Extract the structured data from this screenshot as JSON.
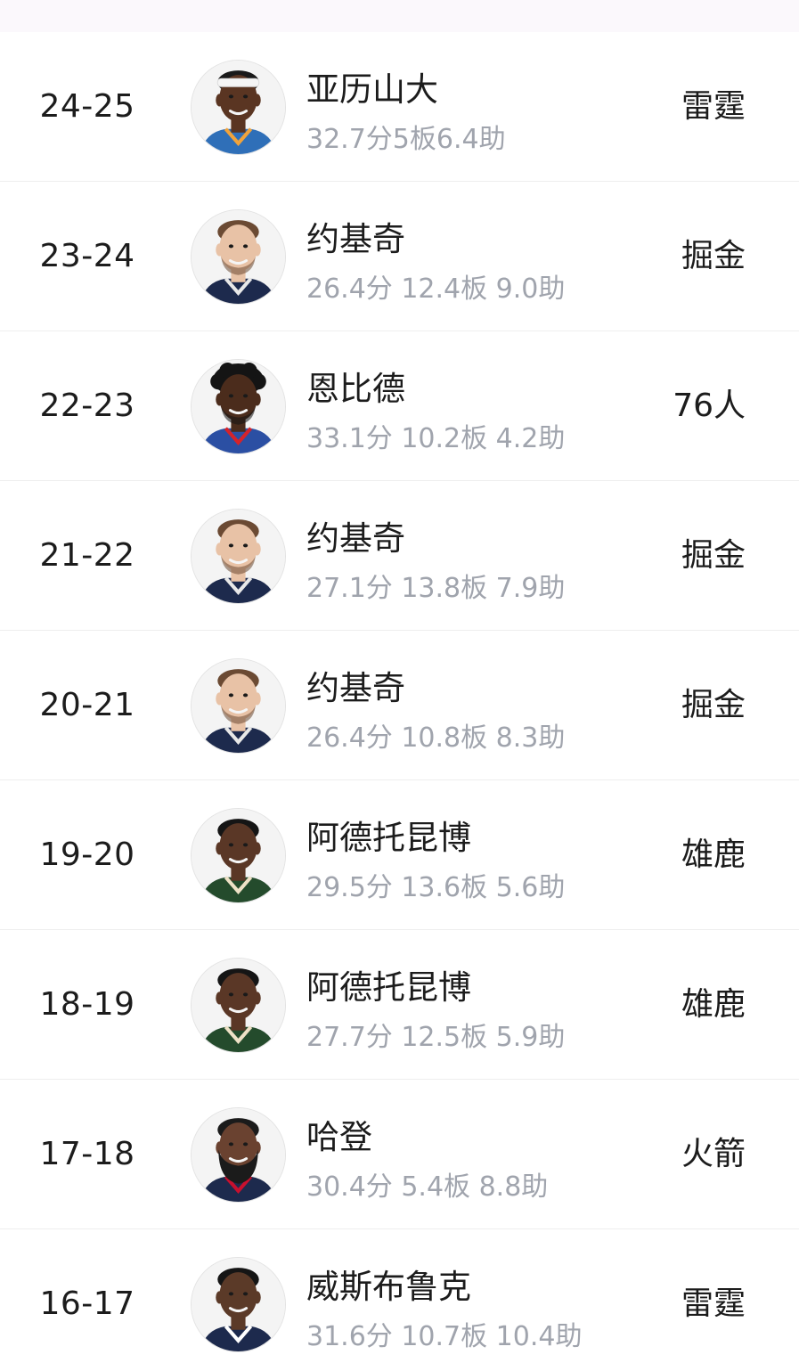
{
  "colors": {
    "top_strip": "#fbf8fc",
    "primary_text": "#1c1c1c",
    "secondary_text": "#a0a4ad",
    "divider": "#eeeeee"
  },
  "rows": [
    {
      "season": "24-25",
      "player": "亚历山大",
      "stats": "32.7分5板6.4助",
      "team": "雷霆",
      "avatar_icon": "player-photo-icon",
      "skin": "#5a3522",
      "hair": "#1a1a1a",
      "jersey": "#2f6fb8",
      "trim": "#f2a33a",
      "headband": true,
      "beard": "none",
      "big_hair": false
    },
    {
      "season": "23-24",
      "player": "约基奇",
      "stats": "26.4分 12.4板 9.0助",
      "team": "掘金",
      "avatar_icon": "player-photo-icon",
      "skin": "#e8c2a6",
      "hair": "#6b4a33",
      "jersey": "#1d2a4d",
      "trim": "#e8e8e8",
      "headband": false,
      "beard": "light",
      "big_hair": false
    },
    {
      "season": "22-23",
      "player": "恩比德",
      "stats": "33.1分 10.2板 4.2助",
      "team": "76人",
      "avatar_icon": "player-photo-icon",
      "skin": "#4b2c1c",
      "hair": "#141414",
      "jersey": "#2b4fa3",
      "trim": "#d6232a",
      "headband": false,
      "beard": "light",
      "big_hair": true
    },
    {
      "season": "21-22",
      "player": "约基奇",
      "stats": "27.1分 13.8板 7.9助",
      "team": "掘金",
      "avatar_icon": "player-photo-icon",
      "skin": "#e8c2a6",
      "hair": "#6b4a33",
      "jersey": "#1d2a4d",
      "trim": "#e8e8e8",
      "headband": false,
      "beard": "light",
      "big_hair": false
    },
    {
      "season": "20-21",
      "player": "约基奇",
      "stats": "26.4分 10.8板 8.3助",
      "team": "掘金",
      "avatar_icon": "player-photo-icon",
      "skin": "#e8c2a6",
      "hair": "#6b4a33",
      "jersey": "#1d2a4d",
      "trim": "#e8e8e8",
      "headband": false,
      "beard": "light",
      "big_hair": false
    },
    {
      "season": "19-20",
      "player": "阿德托昆博",
      "stats": "29.5分 13.6板 5.6助",
      "team": "雄鹿",
      "avatar_icon": "player-photo-icon",
      "skin": "#5a3726",
      "hair": "#151515",
      "jersey": "#244b2c",
      "trim": "#eee1c6",
      "headband": false,
      "beard": "none",
      "big_hair": false
    },
    {
      "season": "18-19",
      "player": "阿德托昆博",
      "stats": "27.7分 12.5板 5.9助",
      "team": "雄鹿",
      "avatar_icon": "player-photo-icon",
      "skin": "#5a3726",
      "hair": "#151515",
      "jersey": "#244b2c",
      "trim": "#eee1c6",
      "headband": false,
      "beard": "none",
      "big_hair": false
    },
    {
      "season": "17-18",
      "player": "哈登",
      "stats": "30.4分 5.4板 8.8助",
      "team": "火箭",
      "avatar_icon": "player-photo-icon",
      "skin": "#6a4230",
      "hair": "#1b1b1b",
      "jersey": "#1d2a4d",
      "trim": "#c8102e",
      "headband": false,
      "beard": "full",
      "big_hair": false
    },
    {
      "season": "16-17",
      "player": "威斯布鲁克",
      "stats": "31.6分 10.7板 10.4助",
      "team": "雷霆",
      "avatar_icon": "player-photo-icon",
      "skin": "#5b3a28",
      "hair": "#151515",
      "jersey": "#1d2a4d",
      "trim": "#ffffff",
      "headband": false,
      "beard": "none",
      "big_hair": false
    }
  ]
}
